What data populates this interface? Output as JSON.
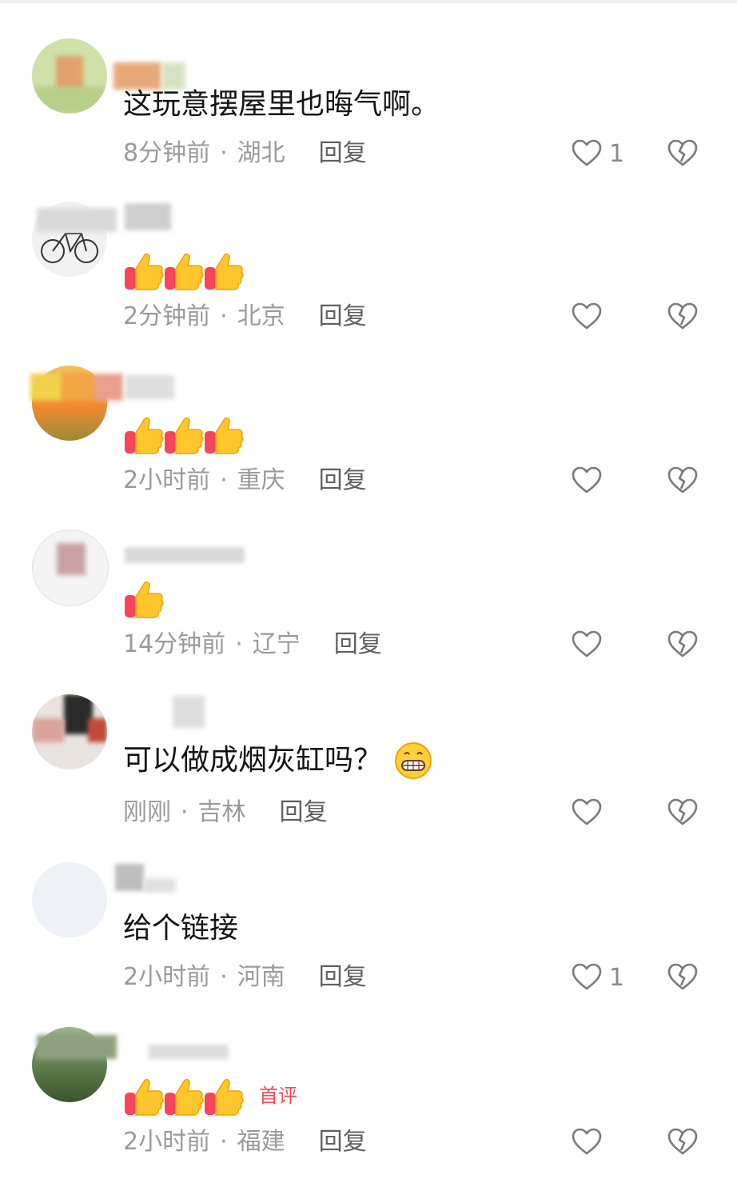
{
  "comments": [
    {
      "text": "这玩意摆屋里也晦气啊。",
      "time": "8分钟前",
      "location": "湖北",
      "reply": "回复",
      "likes": "1",
      "thumbs": 0,
      "badge": ""
    },
    {
      "text": "",
      "time": "2分钟前",
      "location": "北京",
      "reply": "回复",
      "likes": "",
      "thumbs": 3,
      "badge": ""
    },
    {
      "text": "",
      "time": "2小时前",
      "location": "重庆",
      "reply": "回复",
      "likes": "",
      "thumbs": 3,
      "badge": ""
    },
    {
      "text": "",
      "time": "14分钟前",
      "location": "辽宁",
      "reply": "回复",
      "likes": "",
      "thumbs": 1,
      "badge": ""
    },
    {
      "text": "可以做成烟灰缸吗？",
      "time": "刚刚",
      "location": "吉林",
      "reply": "回复",
      "likes": "",
      "thumbs": 0,
      "badge": "",
      "emoji": "grin-emoji"
    },
    {
      "text": "给个链接",
      "time": "2小时前",
      "location": "河南",
      "reply": "回复",
      "likes": "1",
      "thumbs": 0,
      "badge": ""
    },
    {
      "text": "",
      "time": "2小时前",
      "location": "福建",
      "reply": "回复",
      "likes": "",
      "thumbs": 3,
      "badge": "首评"
    }
  ],
  "icons": {
    "like": "heart-outline-icon",
    "dislike": "broken-heart-icon",
    "thumb": "thumbs-up-emoji"
  },
  "colors": {
    "badge": "#f24d57",
    "meta": "#9a9a9a",
    "reply": "#5f5f5f"
  }
}
